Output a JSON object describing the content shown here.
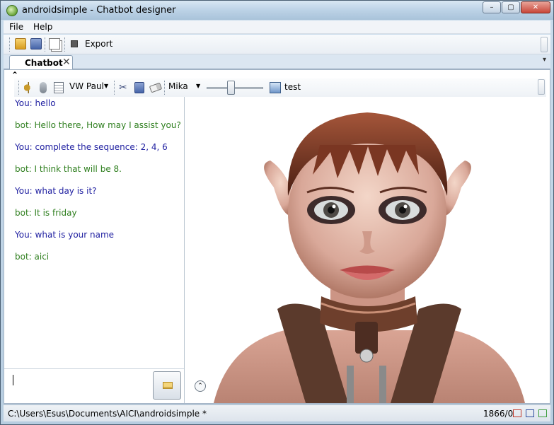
{
  "window": {
    "title": "androidsimple - Chatbot designer",
    "controls": {
      "minimize": "–",
      "maximize": "▢",
      "close": "✕"
    }
  },
  "menu": {
    "items": [
      "File",
      "Help"
    ]
  },
  "toolbar": {
    "export_label": "Export"
  },
  "tabs": [
    {
      "label": "Chatbot",
      "close": "✕"
    }
  ],
  "tab_menu_glyph": "▾",
  "chat_toolbar": {
    "voice": "VW Paul",
    "character": "Mika",
    "slider_fraction": 0.42,
    "test_label": "test"
  },
  "conversation": [
    {
      "speaker": "you",
      "text": "You: hello"
    },
    {
      "speaker": "bot",
      "text": "bot: Hello there, How may I assist you?"
    },
    {
      "speaker": "you",
      "text": "You: complete the sequence: 2, 4, 6"
    },
    {
      "speaker": "bot",
      "text": "bot: I think that will be 8."
    },
    {
      "speaker": "you",
      "text": "You: what day is it?"
    },
    {
      "speaker": "bot",
      "text": "bot: It is friday"
    },
    {
      "speaker": "you",
      "text": "You: what is your name"
    },
    {
      "speaker": "bot",
      "text": "bot: aici"
    }
  ],
  "input": {
    "value": ""
  },
  "status": {
    "path": "C:\\Users\\Esus\\Documents\\AICI\\androidsimple  *",
    "count": "1866/0",
    "indicator_colors": [
      "#c0392b",
      "#2f4f9f",
      "#3f9f3f"
    ]
  },
  "colors": {
    "you_text": "#1e1ea0",
    "bot_text": "#2f7f1f"
  }
}
